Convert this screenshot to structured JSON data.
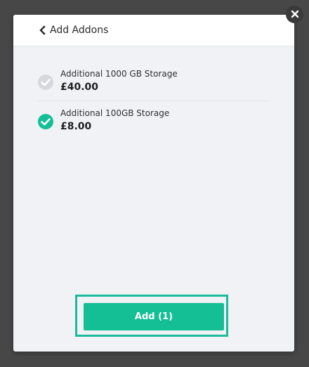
{
  "header": {
    "back_label": "Add Addons"
  },
  "addons": [
    {
      "name": "Additional 1000 GB Storage",
      "price": "£40.00",
      "selected": false
    },
    {
      "name": "Additional 100GB Storage",
      "price": "£8.00",
      "selected": true
    }
  ],
  "footer": {
    "add_label": "Add (1)"
  },
  "colors": {
    "accent": "#14bf95",
    "unselected_check": "#d6d8dd",
    "backdrop": "#474747"
  },
  "icons": {
    "back": "chevron-left-icon",
    "close": "close-icon",
    "check": "check-circle-icon"
  }
}
